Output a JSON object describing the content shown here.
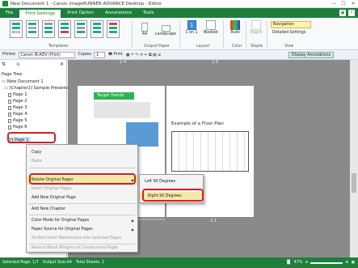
{
  "window": {
    "title": "New Document 1 - Canon imageRUNNER ADVANCE Desktop - Editor"
  },
  "tabs": [
    "File",
    "Print Settings",
    "Print Option",
    "Annotations",
    "Tools"
  ],
  "active_tab": "Print Settings",
  "ribbon": {
    "groups": [
      "Templates",
      "Output Paper",
      "Layout",
      "Color",
      "Staple",
      "View"
    ],
    "buttons": {
      "paper": "A4",
      "orientation": "Landscape",
      "layout": "1 on 1",
      "booklet": "Booklet",
      "color": "Auto",
      "staple": "Staple"
    },
    "view_options": [
      "Navigation",
      "Detailed Settings"
    ]
  },
  "toolbar": {
    "printer_label": "Printer:",
    "printer_value": "Canon iR-ADV (Print)",
    "copies_label": "Copies:",
    "copies_value": "1",
    "print_label": "Print",
    "display_annotations": "Display Annotations"
  },
  "page_tree": {
    "title": "Page Tree",
    "root": "New Document 1",
    "chapter": "[Chapter1] Sample Presentatio",
    "pages": [
      "Page 1",
      "Page 2",
      "Page 3",
      "Page 4",
      "Page 5",
      "Page 6"
    ],
    "selected": "Page 1"
  },
  "document": {
    "page_labels": [
      "1-4",
      "1-5",
      "2-1"
    ],
    "page_left_heading": "Target Trends",
    "page_right_heading": "Example of a Floor Plan"
  },
  "context_menu": {
    "items": [
      {
        "label": "Copy",
        "disabled": false
      },
      {
        "label": "Paste",
        "disabled": true
      },
      {
        "label": "Rotate Original Pages",
        "disabled": false,
        "submenu": true
      },
      {
        "label": "Insert Original Pages",
        "disabled": true
      },
      {
        "label": "Add New Original Page",
        "disabled": false
      },
      {
        "label": "Add New Chapter",
        "disabled": false
      },
      {
        "label": "Color Mode for Original Pages",
        "disabled": false,
        "submenu": true
      },
      {
        "label": "Paper Source for Original Pages",
        "disabled": false,
        "submenu": true
      },
      {
        "label": "Do Not Insert Watermarks into Selected Pages",
        "disabled": true
      },
      {
        "label": "Reduce Blank Margins on Consecutive Pages",
        "disabled": true
      }
    ],
    "submenu": [
      "Left 90 Degrees",
      "Right 90 Degrees"
    ]
  },
  "status": {
    "selected_page": "Selected Page: 1/7",
    "output_size": "Output Size:A4",
    "total_sheets": "Total Sheets: 2",
    "zoom": "47%"
  },
  "colors": {
    "accent": "#1e7f3a",
    "highlight": "#d81e1e",
    "menu_hover": "#f5e7a8"
  }
}
